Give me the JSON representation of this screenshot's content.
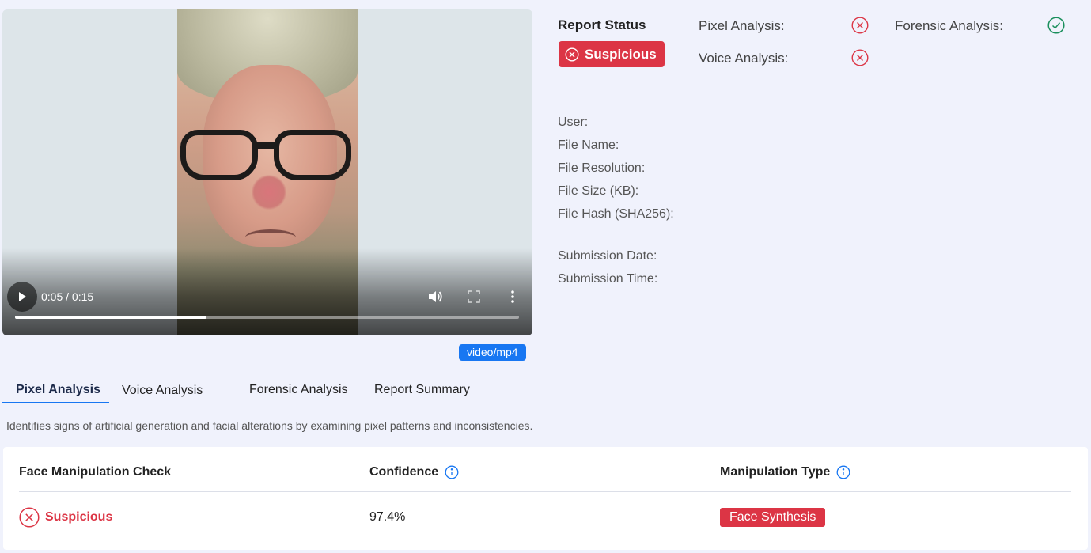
{
  "video": {
    "time_display": "0:05 / 0:15",
    "progress": 0.38,
    "mime": "video/mp4"
  },
  "report": {
    "title": "Report Status",
    "status": "Suspicious",
    "analyses": [
      {
        "label": "Pixel Analysis:",
        "state": "fail",
        "icon": "x-circle-icon"
      },
      {
        "label": "Voice Analysis:",
        "state": "fail",
        "icon": "x-circle-icon"
      },
      {
        "label": "Forensic Analysis:",
        "state": "pass",
        "icon": "check-circle-icon"
      }
    ]
  },
  "meta": {
    "user": "User:",
    "file_name": "File Name:",
    "file_resolution": "File Resolution:",
    "file_size": "File Size (KB):",
    "file_hash": "File Hash (SHA256):",
    "submission_date": "Submission Date:",
    "submission_time": "Submission Time:"
  },
  "tabs": [
    {
      "label": "Pixel Analysis",
      "active": true
    },
    {
      "label": "Voice Analysis",
      "active": false
    },
    {
      "label": "Forensic Analysis",
      "active": false
    },
    {
      "label": "Report Summary",
      "active": false
    }
  ],
  "description": "Identifies signs of artificial generation and facial alterations by examining pixel patterns and inconsistencies.",
  "table": {
    "headers": [
      "Face Manipulation Check",
      "Confidence",
      "Manipulation Type"
    ],
    "row": {
      "result": "Suspicious",
      "confidence": "97.4%",
      "type": "Face Synthesis"
    }
  },
  "colors": {
    "danger": "#dc3545",
    "success": "#1a8f5c",
    "accent": "#1877f2",
    "background": "#f0f2fc"
  }
}
